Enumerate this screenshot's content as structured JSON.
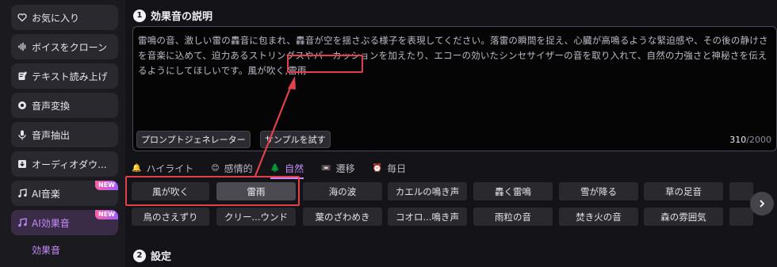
{
  "sidebar": {
    "items": [
      {
        "label": "お気に入り",
        "icon": "heart-icon"
      },
      {
        "label": "ボイスをクローン",
        "icon": "waveform-icon"
      },
      {
        "label": "テキスト読み上げ",
        "icon": "document-edit-icon"
      },
      {
        "label": "音声変換",
        "icon": "voice-change-icon"
      },
      {
        "label": "音声抽出",
        "icon": "microphone-icon"
      },
      {
        "label": "オーディオダウ...",
        "icon": "download-icon"
      },
      {
        "label": "AI音楽",
        "icon": "music-note-icon",
        "badge": "NEW"
      },
      {
        "label": "AI効果音",
        "icon": "music-note-icon",
        "badge": "NEW"
      }
    ],
    "sub_item": "効果音"
  },
  "section1": {
    "number": "1",
    "title": "効果音の説明",
    "description": "雷鳴の音、激しい雷の轟音に包まれ、轟音が空を揺さぶる様子を表現してください。落雷の瞬間を捉え、心臓が高鳴るような緊迫感や、その後の静けさを音楽に込めて、迫力あるストリングスやパーカッションを加えたり、エコーの効いたシンセサイザーの音を取り入れて、自然の力強さと神秘さを伝えるようにしてほしいです。風が吹く,雷雨",
    "prompt_generator_label": "プロンプトジェネレーター",
    "try_sample_label": "サンプルを試す",
    "char_count": "310",
    "char_max": "/2000"
  },
  "tabs": [
    {
      "label": "ハイライト",
      "icon": "bell-icon"
    },
    {
      "label": "感情的",
      "icon": "smile-icon"
    },
    {
      "label": "自然",
      "icon": "tree-icon",
      "active": true
    },
    {
      "label": "遷移",
      "icon": "film-icon"
    },
    {
      "label": "毎日",
      "icon": "alarm-clock-icon"
    }
  ],
  "chips_row1": [
    "風が吹く",
    "雷雨",
    "海の波",
    "カエルの鳴き声",
    "轟く雷鳴",
    "雪が降る",
    "草の足音",
    ""
  ],
  "chips_row2": [
    "鳥のさえずり",
    "クリー...ウンド",
    "葉のざわめき",
    "コオロ...鳴き声",
    "雨粒の音",
    "焚き火の音",
    "森の雰囲気",
    ""
  ],
  "selected_chips": [
    "風が吹く",
    "雷雨"
  ],
  "section2": {
    "number": "2",
    "title": "設定"
  },
  "colors": {
    "accent": "#c78cff",
    "highlight": "#e0414a",
    "background": "#141317"
  }
}
